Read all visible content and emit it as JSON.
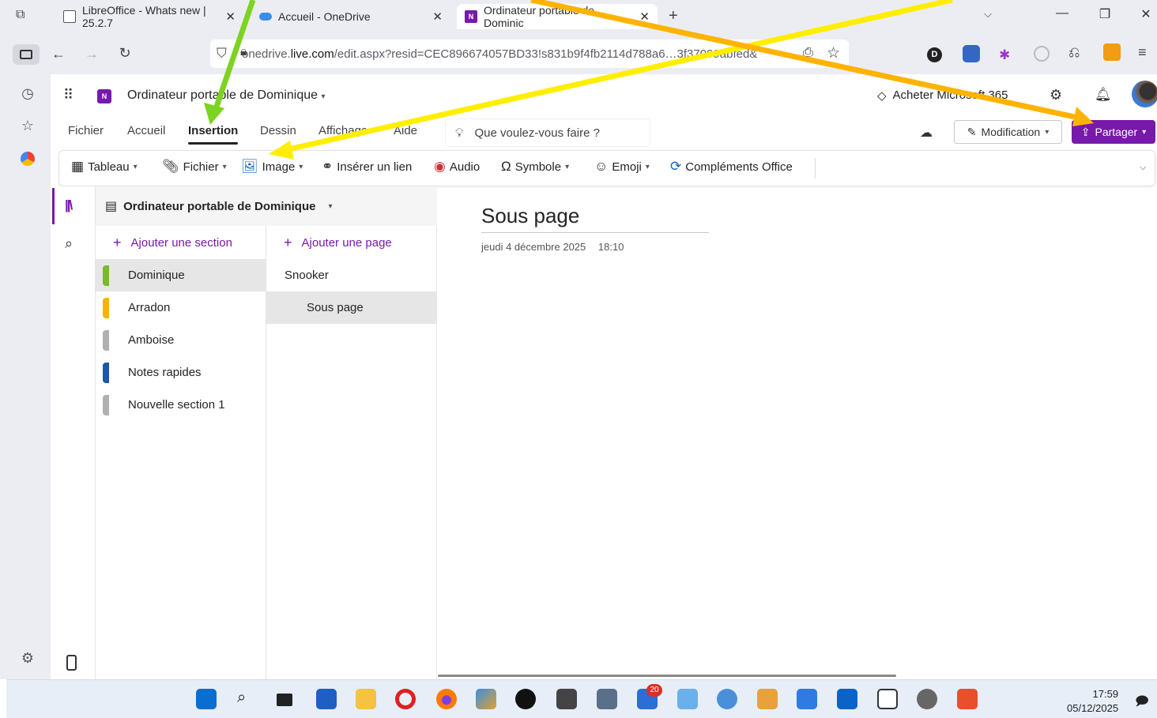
{
  "browser": {
    "tabs": [
      {
        "title": "LibreOffice - Whats new | 25.2.7",
        "close": "✕"
      },
      {
        "title": "Accueil - OneDrive",
        "close": "✕"
      },
      {
        "title": "Ordinateur portable de Dominic",
        "close": "✕"
      }
    ],
    "new_tab": "+",
    "url_prefix": "onedrive.",
    "url_domain": "live.com",
    "url_rest": "/edit.aspx?resid=CEC896674057BD33!s831b9f4fb2114d788a6…3f37099abfed&"
  },
  "app": {
    "notebook_title": "Ordinateur portable de Dominique",
    "buy_label": "Acheter Microsoft 365",
    "menu_tabs": [
      "Fichier",
      "Accueil",
      "Insertion",
      "Dessin",
      "Affichage",
      "Aide"
    ],
    "active_tab": "Insertion",
    "search_placeholder": "Que voulez-vous faire ?",
    "edit_mode": "Modification",
    "share_label": "Partager",
    "ribbon": {
      "table": "Tableau",
      "file": "Fichier",
      "image": "Image",
      "link": "Insérer un lien",
      "audio": "Audio",
      "symbol": "Symbole",
      "emoji": "Emoji",
      "addins": "Compléments Office"
    }
  },
  "notebook": {
    "name": "Ordinateur portable de Dominique",
    "add_section": "Ajouter une section",
    "add_page": "Ajouter une page",
    "sections": [
      {
        "name": "Dominique",
        "color": "#7cb82f",
        "selected": true
      },
      {
        "name": "Arradon",
        "color": "#f4b400",
        "selected": false
      },
      {
        "name": "Amboise",
        "color": "#b0b0b0",
        "selected": false
      },
      {
        "name": "Notes rapides",
        "color": "#1a5aa0",
        "selected": false
      },
      {
        "name": "Nouvelle section 1",
        "color": "#b0b0b0",
        "selected": false
      }
    ],
    "pages": [
      {
        "name": "Snooker",
        "selected": false
      },
      {
        "name": "Sous page",
        "selected": true
      }
    ]
  },
  "page": {
    "title": "Sous page",
    "date": "jeudi 4 décembre 2025",
    "time": "18:10"
  },
  "taskbar": {
    "time": "17:59",
    "date": "05/12/2025",
    "badge": "20"
  },
  "colors": {
    "accent": "#7719aa",
    "arrow_green": "#7dd321",
    "arrow_yellow": "#ffee00",
    "arrow_orange": "#ffb300"
  }
}
